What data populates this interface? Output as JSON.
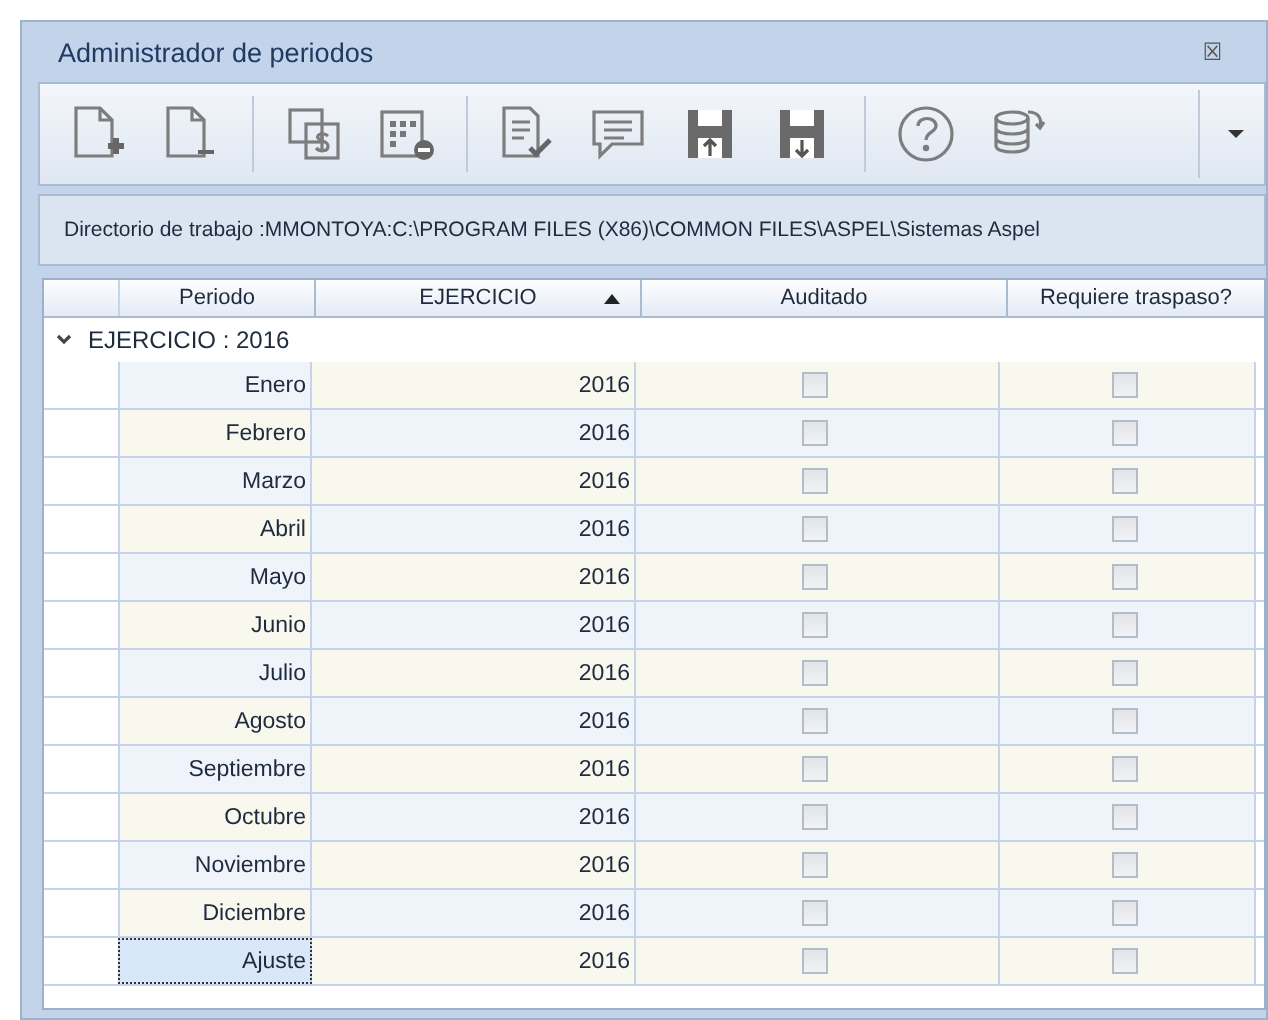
{
  "window": {
    "title": "Administrador de periodos",
    "close": "☒"
  },
  "toolbar": [
    {
      "kind": "new-doc"
    },
    {
      "kind": "remove-doc"
    },
    {
      "kind": "sep"
    },
    {
      "kind": "currency"
    },
    {
      "kind": "calendar-minus"
    },
    {
      "kind": "sep"
    },
    {
      "kind": "doc-check"
    },
    {
      "kind": "comment"
    },
    {
      "kind": "save-up"
    },
    {
      "kind": "save-down"
    },
    {
      "kind": "sep"
    },
    {
      "kind": "help"
    },
    {
      "kind": "database"
    }
  ],
  "directory": "Directorio de trabajo :MMONTOYA:C:\\PROGRAM FILES (X86)\\COMMON FILES\\ASPEL\\Sistemas Aspel",
  "table": {
    "columns": [
      {
        "label": "Periodo",
        "sorted": false
      },
      {
        "label": "EJERCICIO",
        "sorted": true
      },
      {
        "label": "Auditado",
        "sorted": false
      },
      {
        "label": "Requiere traspaso?",
        "sorted": false
      }
    ],
    "group": {
      "label": "EJERCICIO : 2016",
      "expanded": true
    },
    "rows": [
      {
        "periodo": "Enero",
        "ejercicio": "2016",
        "auditado": false,
        "traspaso": false,
        "selected": false
      },
      {
        "periodo": "Febrero",
        "ejercicio": "2016",
        "auditado": false,
        "traspaso": false,
        "selected": false
      },
      {
        "periodo": "Marzo",
        "ejercicio": "2016",
        "auditado": false,
        "traspaso": false,
        "selected": false
      },
      {
        "periodo": "Abril",
        "ejercicio": "2016",
        "auditado": false,
        "traspaso": false,
        "selected": false
      },
      {
        "periodo": "Mayo",
        "ejercicio": "2016",
        "auditado": false,
        "traspaso": false,
        "selected": false
      },
      {
        "periodo": "Junio",
        "ejercicio": "2016",
        "auditado": false,
        "traspaso": false,
        "selected": false
      },
      {
        "periodo": "Julio",
        "ejercicio": "2016",
        "auditado": false,
        "traspaso": false,
        "selected": false
      },
      {
        "periodo": "Agosto",
        "ejercicio": "2016",
        "auditado": false,
        "traspaso": false,
        "selected": false
      },
      {
        "periodo": "Septiembre",
        "ejercicio": "2016",
        "auditado": false,
        "traspaso": false,
        "selected": false
      },
      {
        "periodo": "Octubre",
        "ejercicio": "2016",
        "auditado": false,
        "traspaso": false,
        "selected": false
      },
      {
        "periodo": "Noviembre",
        "ejercicio": "2016",
        "auditado": false,
        "traspaso": false,
        "selected": false
      },
      {
        "periodo": "Diciembre",
        "ejercicio": "2016",
        "auditado": false,
        "traspaso": false,
        "selected": false
      },
      {
        "periodo": "Ajuste",
        "ejercicio": "2016",
        "auditado": false,
        "traspaso": false,
        "selected": true
      }
    ]
  }
}
